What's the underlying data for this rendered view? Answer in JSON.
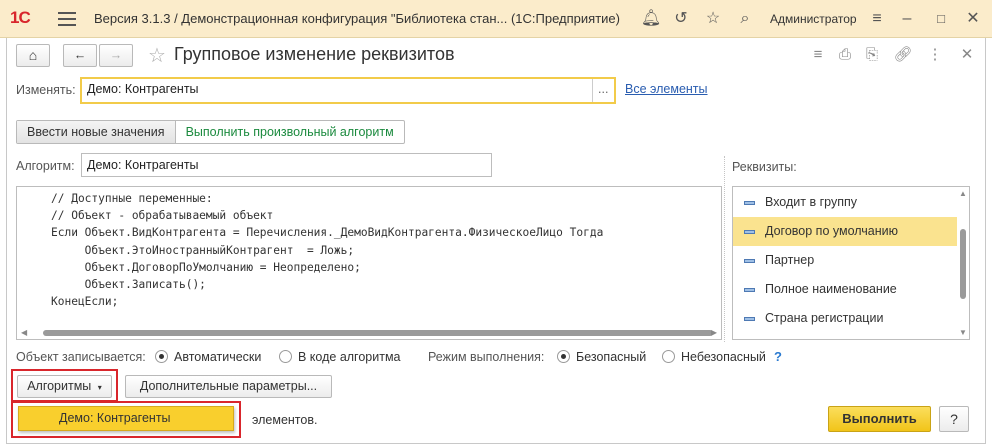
{
  "titlebar": {
    "logo": "1С",
    "title": "Версия 3.1.3 / Демонстрационная конфигурация \"Библиотека стан...   (1С:Предприятие)",
    "user": "Администратор"
  },
  "form": {
    "title": "Групповое изменение реквизитов",
    "change_label": "Изменять:",
    "change_value": "Демо: Контрагенты",
    "select_btn": "...",
    "all_elements_link": "Все элементы",
    "tabs": [
      "Ввести новые значения",
      "Выполнить произвольный алгоритм"
    ],
    "algorithm_label": "Алгоритм:",
    "algorithm_value": "Демо: Контрагенты",
    "code": "// Доступные переменные:\n// Объект - обрабатываемый объект\nЕсли Объект.ВидКонтрагента = Перечисления._ДемоВидКонтрагента.ФизическоеЛицо Тогда\n     Объект.ЭтоИностранныйКонтрагент  = Ложь;\n     Объект.ДоговорПоУмолчанию = Неопределено;\n     Объект.Записать();\nКонецЕсли;",
    "requisites_label": "Реквизиты:",
    "requisites": [
      {
        "label": "Входит в группу",
        "selected": false
      },
      {
        "label": "Договор по умолчанию",
        "selected": true
      },
      {
        "label": "Партнер",
        "selected": false
      },
      {
        "label": "Полное наименование",
        "selected": false
      },
      {
        "label": "Страна регистрации",
        "selected": false
      }
    ],
    "write_label": "Объект записывается:",
    "write_auto": "Автоматически",
    "write_code": "В коде алгоритма",
    "mode_label": "Режим выполнения:",
    "mode_safe": "Безопасный",
    "mode_unsafe": "Небезопасный",
    "help_mark": "?",
    "algorithms_btn": "Алгоритмы",
    "extra_params_btn": "Дополнительные параметры...",
    "dropdown_item": "Демо: Контрагенты",
    "status_text": "элементов.",
    "run_btn": "Выполнить",
    "help_btn": "?"
  },
  "colors": {
    "accent": "#f9cf2d",
    "highlight_frame": "#d9262c",
    "link": "#2a5db0",
    "green_tab": "#1b8a3e",
    "titlebar_bg": "#fbeccb"
  }
}
